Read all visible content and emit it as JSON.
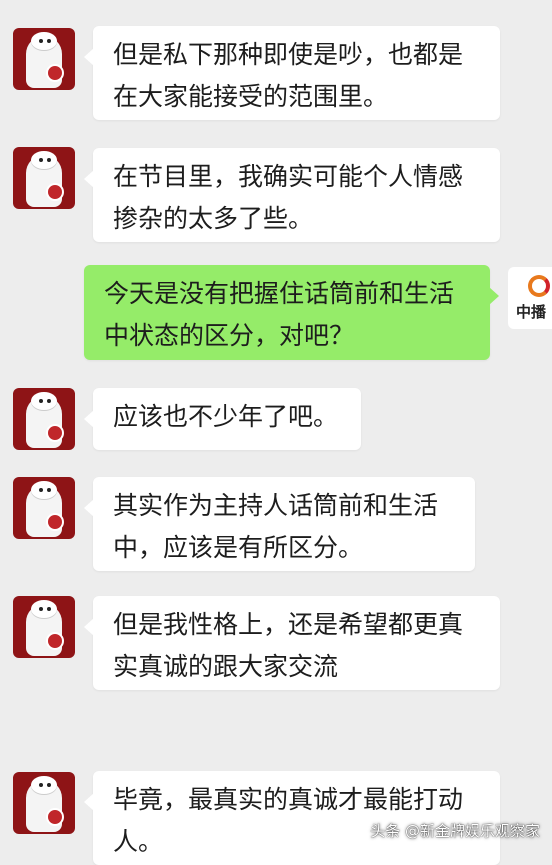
{
  "messages": [
    {
      "side": "left",
      "lines": [
        "但是私下那种即使是吵，也都是",
        "在大家能接受的范围里。"
      ]
    },
    {
      "side": "left",
      "lines": [
        "在节目里，我确实可能个人情感",
        "掺杂的太多了些。"
      ]
    },
    {
      "side": "right",
      "lines": [
        "今天是没有把握住话筒前和生活",
        "中状态的区分，对吧？"
      ]
    },
    {
      "side": "left",
      "lines": [
        "应该也不少年了吧。"
      ]
    },
    {
      "side": "left",
      "lines": [
        "其实作为主持人话筒前和生活",
        "中，应该是有所区分。"
      ]
    },
    {
      "side": "left",
      "lines": [
        "但是我性格上，还是希望都更真",
        "实真诚的跟大家交流"
      ]
    },
    {
      "side": "left",
      "lines": [
        "毕竟，最真实的真诚才最能打动",
        "人。"
      ]
    }
  ],
  "right_avatar": {
    "text": "中播"
  },
  "watermark": "头条 @新金牌娱乐观察家"
}
